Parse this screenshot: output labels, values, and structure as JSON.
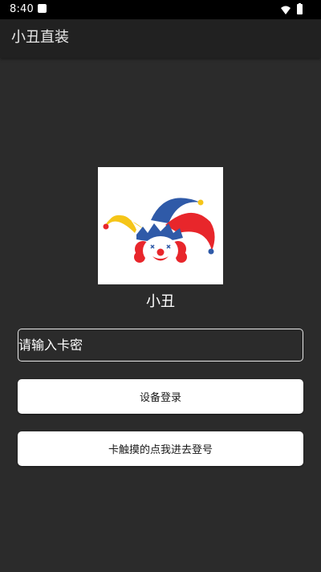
{
  "status_bar": {
    "time": "8:40",
    "icons": [
      "notification-icon",
      "wifi-icon",
      "battery-icon"
    ]
  },
  "app_bar": {
    "title": "小丑直装"
  },
  "logo": {
    "icon": "clown-jester-icon",
    "name": "小丑"
  },
  "login": {
    "card_input_placeholder": "请输入卡密",
    "card_input_value": "",
    "device_login_label": "设备登录",
    "touch_login_label": "卡触摸的点我进去登号"
  },
  "colors": {
    "background": "#2b2b2b",
    "app_bar": "#212121",
    "status_bar": "#000000",
    "button": "#ffffff",
    "jester_yellow": "#f5c518",
    "jester_blue": "#2f5aa8",
    "jester_red": "#e8262b"
  }
}
